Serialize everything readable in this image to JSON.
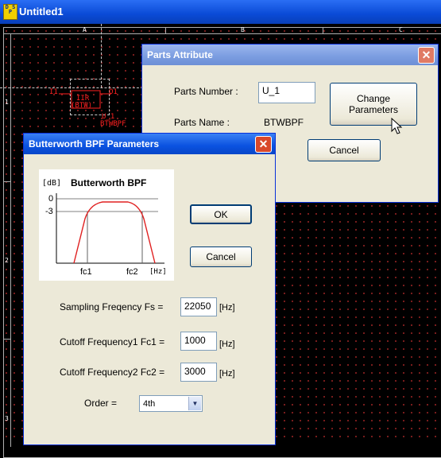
{
  "window": {
    "title": "Untitled1",
    "icon_text": "D S P"
  },
  "sheet": {
    "columns": [
      "A",
      "B",
      "C"
    ],
    "rows": [
      "1",
      "2",
      "3"
    ],
    "part_labels": {
      "left_pin": "I1",
      "right_pin": "O1",
      "body_top": "IIR",
      "body_bottom": "(BTW)",
      "ref": "U_1",
      "name": "BTWBPF"
    }
  },
  "parts_attribute": {
    "title": "Parts Attribute",
    "parts_number_label": "Parts Number :",
    "parts_number_value": "U_1",
    "parts_name_label": "Parts Name :",
    "parts_name_value": "BTWBPF",
    "change_button_line1": "Change",
    "change_button_line2": "Parameters",
    "cancel_label": "Cancel",
    "close_label": "✕"
  },
  "bpf_params": {
    "title": "Butterworth BPF Parameters",
    "close_label": "✕",
    "graph": {
      "title": "Butterworth BPF",
      "ylabel": "[dB]",
      "y0": "0",
      "y3": "-3",
      "fc1": "fc1",
      "fc2": "fc2",
      "xunit": "[Hz]"
    },
    "ok_label": "OK",
    "cancel_label": "Cancel",
    "fs_label": "Sampling Freqency Fs =",
    "fs_value": "22050",
    "fs_unit": "[Hz]",
    "fc1_label": "Cutoff Frequency1 Fc1 =",
    "fc1_value": "1000",
    "fc1_unit": "[Hz]",
    "fc2_label": "Cutoff Frequency2 Fc2 =",
    "fc2_value": "3000",
    "fc2_unit": "[Hz]",
    "order_label": "Order =",
    "order_value": "4th"
  }
}
